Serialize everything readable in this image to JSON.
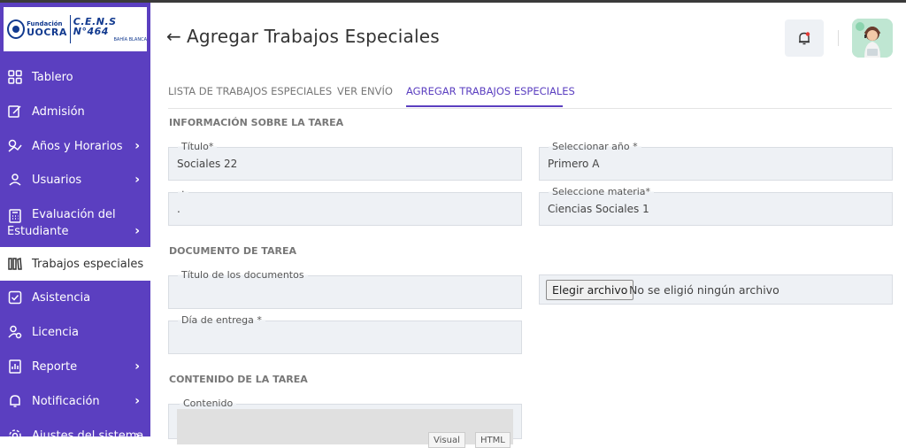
{
  "brand": {
    "org_line1": "Fundación",
    "org_line2": "UOCRA",
    "school_name": "C.E.N.S N°464",
    "school_city": "BAHÍA BLANCA"
  },
  "sidebar": {
    "items": [
      {
        "label": "Tablero",
        "icon": "grid-icon",
        "chevron": false
      },
      {
        "label": "Admisión",
        "icon": "edit-icon",
        "chevron": false
      },
      {
        "label": "Años y Horarios",
        "icon": "schedule-icon",
        "chevron": true
      },
      {
        "label": "Usuarios",
        "icon": "user-icon",
        "chevron": true
      },
      {
        "label_line1": "Evaluación del",
        "label_line2": "Estudiante",
        "icon": "calculator-icon",
        "chevron": true
      },
      {
        "label": "Trabajos especiales",
        "icon": "library-icon",
        "chevron": false,
        "active": true
      },
      {
        "label": "Asistencia",
        "icon": "checkbox-icon",
        "chevron": false
      },
      {
        "label": "Licencia",
        "icon": "person-settings-icon",
        "chevron": false
      },
      {
        "label": "Reporte",
        "icon": "report-icon",
        "chevron": true
      },
      {
        "label": "Notificación",
        "icon": "notification-icon",
        "chevron": true
      },
      {
        "label": "Ajustes del sistema",
        "icon": "gear-icon",
        "chevron": true
      }
    ],
    "chevron_glyph": "›"
  },
  "header": {
    "back_glyph": "←",
    "title": "Agregar Trabajos Especiales"
  },
  "tabs": [
    {
      "label": "LISTA DE TRABAJOS ESPECIALES"
    },
    {
      "label": "VER ENVÍO"
    },
    {
      "label": "AGREGAR TRABAJOS ESPECIALES",
      "active": true
    }
  ],
  "sections": {
    "task_info": "INFORMACIÓN SOBRE LA TAREA",
    "task_document": "DOCUMENTO DE TAREA",
    "task_content": "CONTENIDO DE LA TAREA"
  },
  "form": {
    "title": {
      "label": "Título*",
      "value": "Sociales 22"
    },
    "year": {
      "label": "Seleccionar año *",
      "value": "Primero A"
    },
    "unnamed": {
      "label": "·",
      "value": "."
    },
    "subject": {
      "label": "Seleccione materia*",
      "value": "Ciencias Sociales 1"
    },
    "doc_title": {
      "label": "Título de los documentos",
      "value": ""
    },
    "file": {
      "button": "Elegir archivo",
      "status": "No se eligió ningún archivo"
    },
    "due_date": {
      "label": "Día de entrega *",
      "value": ""
    },
    "content": {
      "label": "Contenido",
      "tab_visual": "Visual",
      "tab_html": "HTML"
    }
  },
  "colors": {
    "sidebar_bg": "#5b3fc0",
    "accent": "#5b3fc0",
    "field_bg": "#eef1f5",
    "notification_dot": "#e53935"
  }
}
